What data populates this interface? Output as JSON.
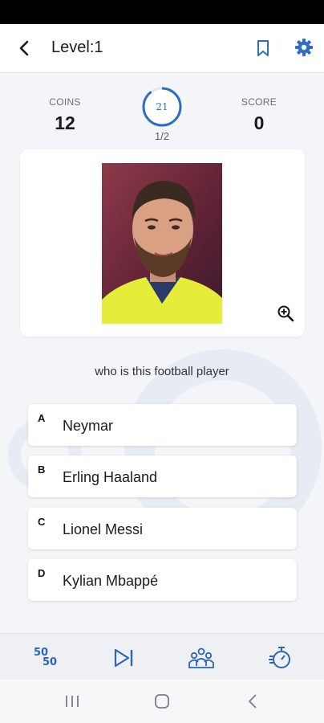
{
  "header": {
    "title": "Level:1"
  },
  "stats": {
    "coins_label": "COINS",
    "coins_value": "12",
    "score_label": "SCORE",
    "score_value": "0",
    "timer_value": "21",
    "progress": "1/2"
  },
  "question": "who is this football player",
  "answers": [
    {
      "letter": "A",
      "text": "Neymar"
    },
    {
      "letter": "B",
      "text": "Erling Haaland"
    },
    {
      "letter": "C",
      "text": "Lionel Messi"
    },
    {
      "letter": "D",
      "text": "Kylian Mbappé"
    }
  ],
  "lifelines": {
    "fifty_top": "50",
    "fifty_bottom": "50"
  },
  "theme": {
    "accent": "#2b6fc2",
    "ring": "#e3e8f3",
    "photo_bg": "#7a2a3a",
    "jersey": "#e6ec3a"
  },
  "icons": [
    "back-arrow-icon",
    "bookmark-icon",
    "gear-icon",
    "zoom-in-icon",
    "skip-next-icon",
    "audience-icon",
    "stopwatch-icon"
  ]
}
